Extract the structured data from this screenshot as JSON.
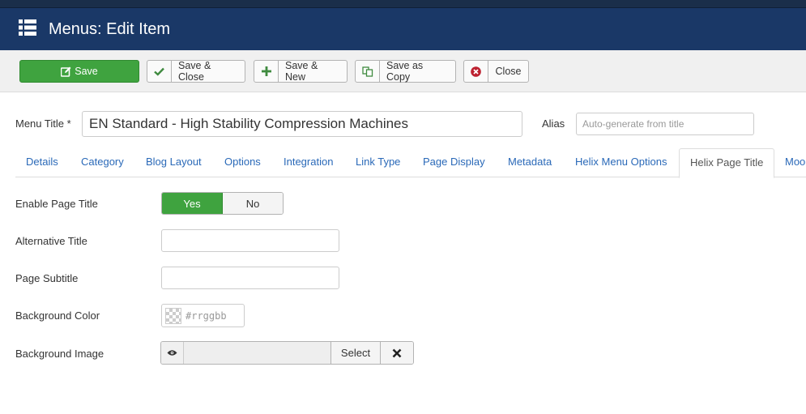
{
  "header": {
    "title": "Menus: Edit Item",
    "icon": "list-icon",
    "color": "#1a3867"
  },
  "toolbar": {
    "save": "Save",
    "save_close": "Save & Close",
    "save_new": "Save & New",
    "save_copy": "Save as Copy",
    "close": "Close"
  },
  "form": {
    "menu_title_label": "Menu Title *",
    "menu_title_value": "EN Standard - High Stability Compression Machines",
    "alias_label": "Alias",
    "alias_placeholder": "Auto-generate from title"
  },
  "tabs": [
    {
      "label": "Details"
    },
    {
      "label": "Category"
    },
    {
      "label": "Blog Layout"
    },
    {
      "label": "Options"
    },
    {
      "label": "Integration"
    },
    {
      "label": "Link Type"
    },
    {
      "label": "Page Display"
    },
    {
      "label": "Metadata"
    },
    {
      "label": "Helix Menu Options"
    },
    {
      "label": "Helix Page Title"
    },
    {
      "label": "Moo"
    }
  ],
  "active_tab": "Helix Page Title",
  "fields": {
    "enable_page_title": {
      "label": "Enable Page Title",
      "yes": "Yes",
      "no": "No",
      "selected": "Yes"
    },
    "alternative_title": {
      "label": "Alternative Title",
      "value": ""
    },
    "page_subtitle": {
      "label": "Page Subtitle",
      "value": ""
    },
    "background_color": {
      "label": "Background Color",
      "placeholder": "#rrggbb"
    },
    "background_image": {
      "label": "Background Image",
      "select": "Select",
      "clear": "✕"
    }
  },
  "colors": {
    "green": "#3fa33f",
    "link": "#2a69b8",
    "header": "#1a3867"
  }
}
